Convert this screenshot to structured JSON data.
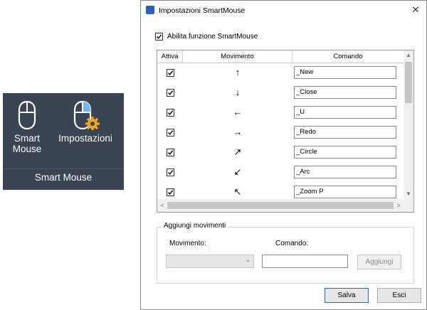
{
  "ribbon": {
    "tools": [
      {
        "label_line1": "Smart",
        "label_line2": "Mouse",
        "icon": "mouse-icon"
      },
      {
        "label_line1": "Impostazioni",
        "label_line2": "",
        "icon": "mouse-gear-icon"
      }
    ],
    "panel_title": "Smart Mouse"
  },
  "dialog": {
    "title": "Impostazioni SmartMouse",
    "close_glyph": "✕",
    "enable_label": "Abilita funzione SmartMouse",
    "enable_checked": true,
    "columns": [
      "Attiva",
      "Movimento",
      "Comando"
    ],
    "rows": [
      {
        "active": true,
        "arrow": "↑",
        "command": "_New"
      },
      {
        "active": true,
        "arrow": "↓",
        "command": "_Close"
      },
      {
        "active": true,
        "arrow": "←",
        "command": "_U"
      },
      {
        "active": true,
        "arrow": "→",
        "command": "_Redo"
      },
      {
        "active": true,
        "arrow": "↗",
        "command": "_Circle"
      },
      {
        "active": true,
        "arrow": "↙",
        "command": "_Arc"
      },
      {
        "active": true,
        "arrow": "↖",
        "command": "_Zoom P"
      }
    ],
    "scroll_glyphs": {
      "up": "▲",
      "down": "▼",
      "left": "<",
      "right": ">"
    },
    "add_group": {
      "legend": "Aggiungi movimenti",
      "movimento_label": "Movimento:",
      "comando_label": "Comando:",
      "combo_value": "",
      "combo_glyph": "⌄",
      "command_value": "",
      "add_button": "Aggiungi"
    },
    "save_button": "Salva",
    "exit_button": "Esci"
  },
  "colors": {
    "ribbon_bg": "#3b4453",
    "accent": "#0078d7",
    "icon_blue": "#2b5fbd"
  }
}
